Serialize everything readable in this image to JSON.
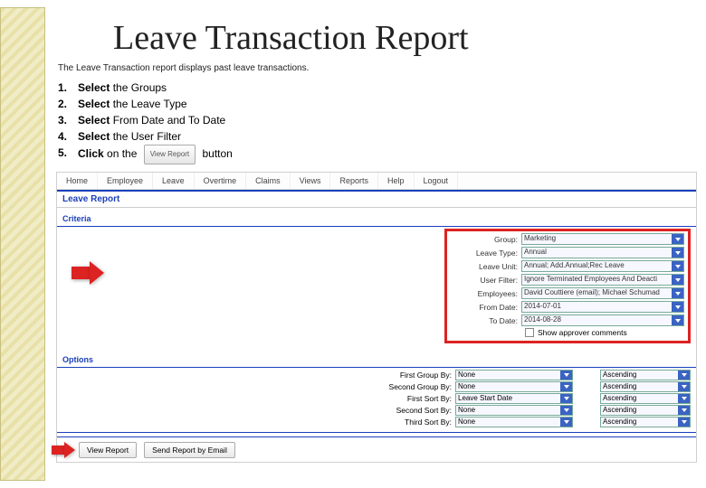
{
  "title": "Leave Transaction Report",
  "subtitle": "The Leave Transaction report displays past leave transactions.",
  "steps": [
    {
      "num": "1.",
      "bold": "Select",
      "rest": "  the Groups"
    },
    {
      "num": "2.",
      "bold": "Select",
      "rest": "  the Leave Type"
    },
    {
      "num": "3.",
      "bold": "Select",
      "rest": "  From Date and To Date"
    },
    {
      "num": "4.",
      "bold": "Select",
      "rest": " the User Filter"
    },
    {
      "num": "5.",
      "bold": "Click",
      "rest_before": " on the ",
      "inline_btn": "View Report",
      "rest_after": " button"
    }
  ],
  "nav": [
    "Home",
    "Employee",
    "Leave",
    "Overtime",
    "Claims",
    "Views",
    "Reports",
    "Help",
    "Logout"
  ],
  "section": "Leave Report",
  "criteria_header": "Criteria",
  "criteria_rows": [
    {
      "label": "Group:",
      "value": "Marketing"
    },
    {
      "label": "Leave Type:",
      "value": "Annual"
    },
    {
      "label": "Leave Unit:",
      "value": "Annual; Add.Annual;Rec Leave"
    },
    {
      "label": "User Filter:",
      "value": "Ignore Terminated Employees And Deacti"
    },
    {
      "label": "Employees:",
      "value": "David Couttiere (email); Michael Schumad"
    },
    {
      "label": "From Date:",
      "value": "2014-07-01"
    },
    {
      "label": "To Date:",
      "value": "2014-08-28"
    }
  ],
  "checkbox_label": "Show approver comments",
  "options_header": "Options",
  "options_rows": [
    {
      "label": "First Group By:",
      "value": "None",
      "sort": "Ascending"
    },
    {
      "label": "Second Group By:",
      "value": "None",
      "sort": "Ascending"
    },
    {
      "label": "First Sort By:",
      "value": "Leave Start Date",
      "sort": "Ascending"
    },
    {
      "label": "Second Sort By:",
      "value": "None",
      "sort": "Ascending"
    },
    {
      "label": "Third Sort By:",
      "value": "None",
      "sort": "Ascending"
    }
  ],
  "buttons": {
    "view_report": "View Report",
    "send_email": "Send Report by Email"
  }
}
